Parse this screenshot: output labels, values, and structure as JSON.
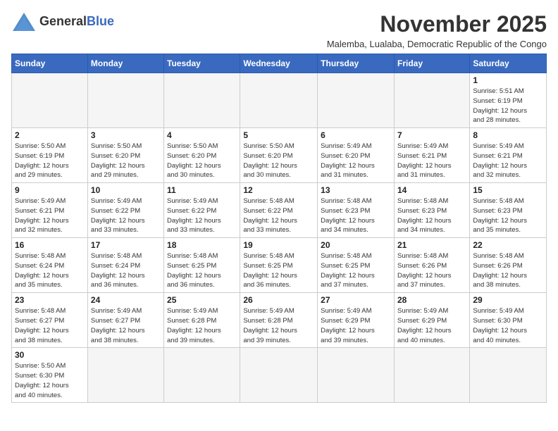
{
  "logo": {
    "text_general": "General",
    "text_blue": "Blue"
  },
  "title": "November 2025",
  "subtitle": "Malemba, Lualaba, Democratic Republic of the Congo",
  "days_of_week": [
    "Sunday",
    "Monday",
    "Tuesday",
    "Wednesday",
    "Thursday",
    "Friday",
    "Saturday"
  ],
  "weeks": [
    [
      {
        "day": "",
        "info": "",
        "empty": true
      },
      {
        "day": "",
        "info": "",
        "empty": true
      },
      {
        "day": "",
        "info": "",
        "empty": true
      },
      {
        "day": "",
        "info": "",
        "empty": true
      },
      {
        "day": "",
        "info": "",
        "empty": true
      },
      {
        "day": "",
        "info": "",
        "empty": true
      },
      {
        "day": "1",
        "info": "Sunrise: 5:51 AM\nSunset: 6:19 PM\nDaylight: 12 hours\nand 28 minutes."
      }
    ],
    [
      {
        "day": "2",
        "info": "Sunrise: 5:50 AM\nSunset: 6:19 PM\nDaylight: 12 hours\nand 29 minutes."
      },
      {
        "day": "3",
        "info": "Sunrise: 5:50 AM\nSunset: 6:20 PM\nDaylight: 12 hours\nand 29 minutes."
      },
      {
        "day": "4",
        "info": "Sunrise: 5:50 AM\nSunset: 6:20 PM\nDaylight: 12 hours\nand 30 minutes."
      },
      {
        "day": "5",
        "info": "Sunrise: 5:50 AM\nSunset: 6:20 PM\nDaylight: 12 hours\nand 30 minutes."
      },
      {
        "day": "6",
        "info": "Sunrise: 5:49 AM\nSunset: 6:20 PM\nDaylight: 12 hours\nand 31 minutes."
      },
      {
        "day": "7",
        "info": "Sunrise: 5:49 AM\nSunset: 6:21 PM\nDaylight: 12 hours\nand 31 minutes."
      },
      {
        "day": "8",
        "info": "Sunrise: 5:49 AM\nSunset: 6:21 PM\nDaylight: 12 hours\nand 32 minutes."
      }
    ],
    [
      {
        "day": "9",
        "info": "Sunrise: 5:49 AM\nSunset: 6:21 PM\nDaylight: 12 hours\nand 32 minutes."
      },
      {
        "day": "10",
        "info": "Sunrise: 5:49 AM\nSunset: 6:22 PM\nDaylight: 12 hours\nand 33 minutes."
      },
      {
        "day": "11",
        "info": "Sunrise: 5:49 AM\nSunset: 6:22 PM\nDaylight: 12 hours\nand 33 minutes."
      },
      {
        "day": "12",
        "info": "Sunrise: 5:48 AM\nSunset: 6:22 PM\nDaylight: 12 hours\nand 33 minutes."
      },
      {
        "day": "13",
        "info": "Sunrise: 5:48 AM\nSunset: 6:23 PM\nDaylight: 12 hours\nand 34 minutes."
      },
      {
        "day": "14",
        "info": "Sunrise: 5:48 AM\nSunset: 6:23 PM\nDaylight: 12 hours\nand 34 minutes."
      },
      {
        "day": "15",
        "info": "Sunrise: 5:48 AM\nSunset: 6:23 PM\nDaylight: 12 hours\nand 35 minutes."
      }
    ],
    [
      {
        "day": "16",
        "info": "Sunrise: 5:48 AM\nSunset: 6:24 PM\nDaylight: 12 hours\nand 35 minutes."
      },
      {
        "day": "17",
        "info": "Sunrise: 5:48 AM\nSunset: 6:24 PM\nDaylight: 12 hours\nand 36 minutes."
      },
      {
        "day": "18",
        "info": "Sunrise: 5:48 AM\nSunset: 6:25 PM\nDaylight: 12 hours\nand 36 minutes."
      },
      {
        "day": "19",
        "info": "Sunrise: 5:48 AM\nSunset: 6:25 PM\nDaylight: 12 hours\nand 36 minutes."
      },
      {
        "day": "20",
        "info": "Sunrise: 5:48 AM\nSunset: 6:25 PM\nDaylight: 12 hours\nand 37 minutes."
      },
      {
        "day": "21",
        "info": "Sunrise: 5:48 AM\nSunset: 6:26 PM\nDaylight: 12 hours\nand 37 minutes."
      },
      {
        "day": "22",
        "info": "Sunrise: 5:48 AM\nSunset: 6:26 PM\nDaylight: 12 hours\nand 38 minutes."
      }
    ],
    [
      {
        "day": "23",
        "info": "Sunrise: 5:48 AM\nSunset: 6:27 PM\nDaylight: 12 hours\nand 38 minutes."
      },
      {
        "day": "24",
        "info": "Sunrise: 5:49 AM\nSunset: 6:27 PM\nDaylight: 12 hours\nand 38 minutes."
      },
      {
        "day": "25",
        "info": "Sunrise: 5:49 AM\nSunset: 6:28 PM\nDaylight: 12 hours\nand 39 minutes."
      },
      {
        "day": "26",
        "info": "Sunrise: 5:49 AM\nSunset: 6:28 PM\nDaylight: 12 hours\nand 39 minutes."
      },
      {
        "day": "27",
        "info": "Sunrise: 5:49 AM\nSunset: 6:29 PM\nDaylight: 12 hours\nand 39 minutes."
      },
      {
        "day": "28",
        "info": "Sunrise: 5:49 AM\nSunset: 6:29 PM\nDaylight: 12 hours\nand 40 minutes."
      },
      {
        "day": "29",
        "info": "Sunrise: 5:49 AM\nSunset: 6:30 PM\nDaylight: 12 hours\nand 40 minutes."
      }
    ],
    [
      {
        "day": "30",
        "info": "Sunrise: 5:50 AM\nSunset: 6:30 PM\nDaylight: 12 hours\nand 40 minutes."
      },
      {
        "day": "",
        "info": "",
        "empty": true
      },
      {
        "day": "",
        "info": "",
        "empty": true
      },
      {
        "day": "",
        "info": "",
        "empty": true
      },
      {
        "day": "",
        "info": "",
        "empty": true
      },
      {
        "day": "",
        "info": "",
        "empty": true
      },
      {
        "day": "",
        "info": "",
        "empty": true
      }
    ]
  ]
}
